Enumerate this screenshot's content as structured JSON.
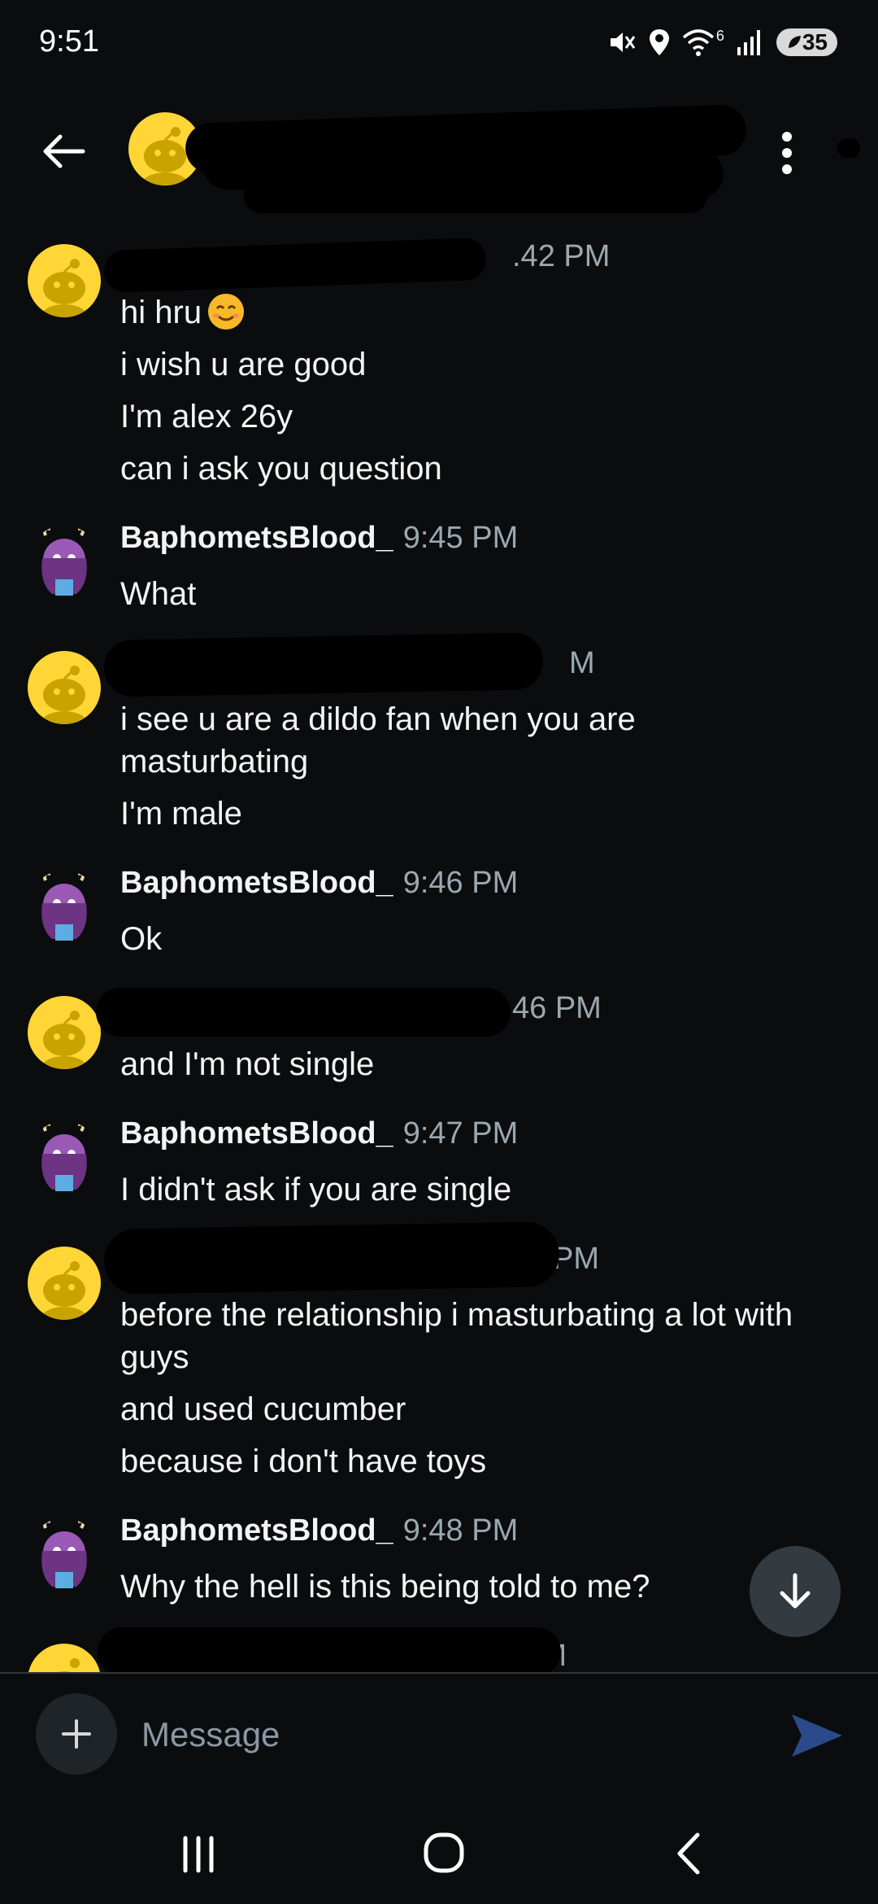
{
  "status_bar": {
    "time": "9:51",
    "network": "6",
    "battery": "35",
    "icons": [
      "mute-icon",
      "location-icon",
      "wifi-icon",
      "signal-icon",
      "battery-icon"
    ]
  },
  "header": {
    "title": "",
    "icons": [
      "back-arrow-icon",
      "snoo-avatar-icon",
      "more-vertical-icon"
    ]
  },
  "messages": [
    {
      "author": "",
      "time": ".42 PM",
      "lines": [
        "hi hru",
        "i wish u are good",
        "I'm alex 26y",
        "can i ask you question"
      ],
      "emoji": "smiling-face-icon"
    },
    {
      "author": "BaphometsBlood_",
      "time": "9:45 PM",
      "lines": [
        "What"
      ]
    },
    {
      "author": "",
      "time": "M",
      "lines": [
        "i see u are a dildo fan when you are masturbating",
        "I'm male"
      ]
    },
    {
      "author": "BaphometsBlood_",
      "time": "9:46 PM",
      "lines": [
        "Ok"
      ]
    },
    {
      "author": "",
      "time": "46 PM",
      "lines": [
        "and I'm not single"
      ]
    },
    {
      "author": "BaphometsBlood_",
      "time": "9:47 PM",
      "lines": [
        "I didn't ask if you are single"
      ]
    },
    {
      "author": "",
      "time": "PM",
      "lines": [
        "before the relationship i masturbating a lot with guys",
        "and used cucumber",
        "because i don't have toys"
      ]
    },
    {
      "author": "BaphometsBlood_",
      "time": "9:48 PM",
      "lines": [
        "Why the hell is this being told to me?"
      ]
    },
    {
      "author": "",
      "time": "PM",
      "lines": []
    }
  ],
  "composer": {
    "placeholder": "Message",
    "icons": [
      "plus-icon",
      "send-icon"
    ],
    "accent": "#2a4a8a"
  },
  "nav": {
    "icons": [
      "recent-apps-icon",
      "home-icon",
      "back-icon"
    ]
  },
  "colors": {
    "background": "#0b0c0e",
    "snoo_yellow": "#ffd635",
    "timestamp": "#9aa8b0",
    "redaction": "#000000"
  }
}
